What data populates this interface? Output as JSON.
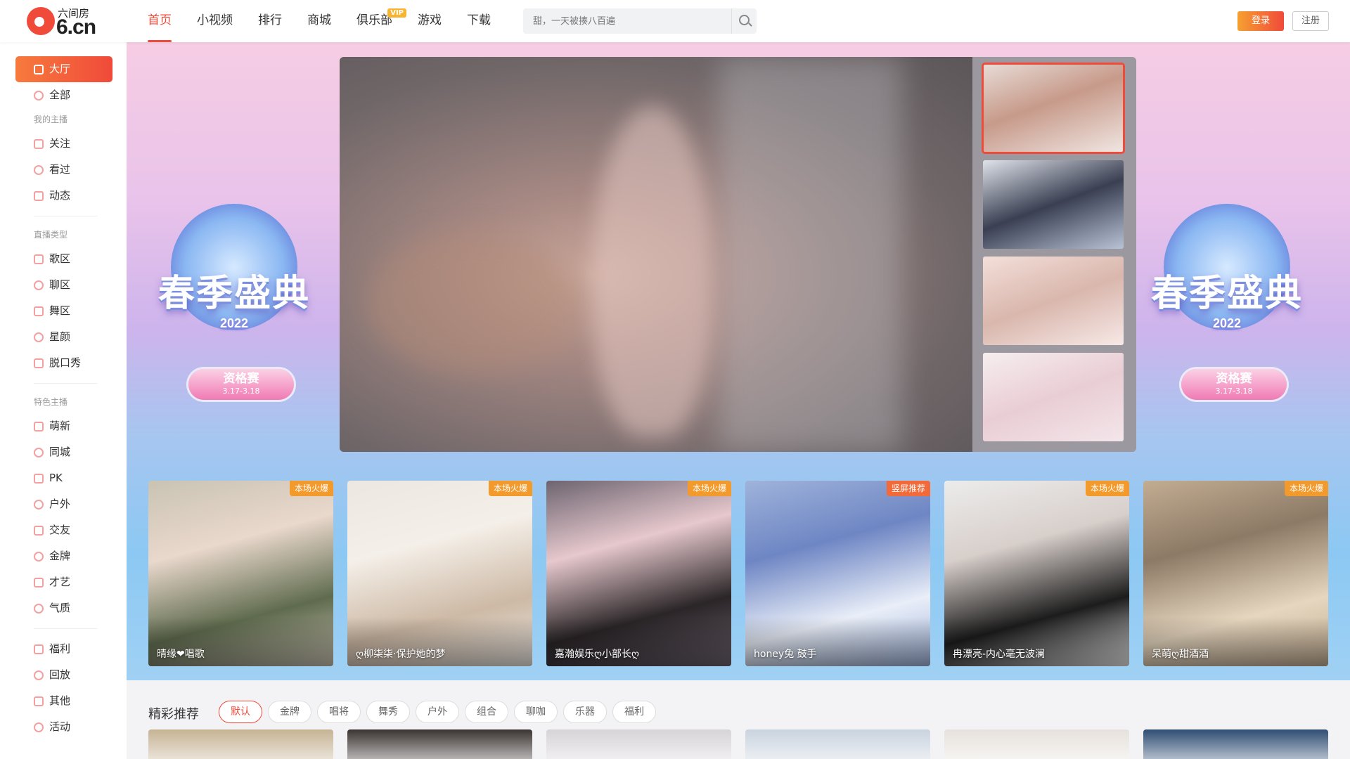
{
  "header": {
    "logo_text": "6.cn",
    "logo_sub": "六间房",
    "nav": [
      {
        "label": "首页",
        "active": true
      },
      {
        "label": "小视频"
      },
      {
        "label": "排行"
      },
      {
        "label": "商城"
      },
      {
        "label": "俱乐部",
        "badge": "VIP"
      },
      {
        "label": "游戏"
      },
      {
        "label": "下载"
      }
    ],
    "search_placeholder": "甜，一天被揍八百遍",
    "login_label": "登录",
    "register_label": "注册"
  },
  "sidebar": {
    "items_top": [
      {
        "label": "大厅",
        "icon": "home-icon",
        "active": true
      },
      {
        "label": "全部",
        "icon": "grid-icon"
      }
    ],
    "group_my": "我的主播",
    "items_my": [
      {
        "label": "关注",
        "icon": "heart-icon"
      },
      {
        "label": "看过",
        "icon": "clock-icon"
      },
      {
        "label": "动态",
        "icon": "message-icon"
      }
    ],
    "group_type": "直播类型",
    "items_type": [
      {
        "label": "歌区",
        "icon": "music-icon"
      },
      {
        "label": "聊区",
        "icon": "chat-icon"
      },
      {
        "label": "舞区",
        "icon": "dance-icon"
      },
      {
        "label": "星颜",
        "icon": "mask-icon"
      },
      {
        "label": "脱口秀",
        "icon": "mic-icon"
      }
    ],
    "group_feature": "特色主播",
    "items_feature": [
      {
        "label": "萌新",
        "icon": "sprout-icon"
      },
      {
        "label": "同城",
        "icon": "location-icon"
      },
      {
        "label": "PK",
        "icon": "lightning-icon"
      },
      {
        "label": "户外",
        "icon": "tent-icon"
      },
      {
        "label": "交友",
        "icon": "friends-icon"
      },
      {
        "label": "金牌",
        "icon": "medal-icon"
      },
      {
        "label": "才艺",
        "icon": "talent-icon"
      },
      {
        "label": "气质",
        "icon": "boot-icon"
      }
    ],
    "items_bottom": [
      {
        "label": "福利",
        "icon": "gift-icon"
      },
      {
        "label": "回放",
        "icon": "replay-icon"
      },
      {
        "label": "其他",
        "icon": "more-icon"
      },
      {
        "label": "活动",
        "icon": "star-icon"
      }
    ]
  },
  "banner": {
    "event_title": "春季盛典",
    "event_year": "2022",
    "event_stage": "资格赛",
    "event_dates": "3.17-3.18"
  },
  "live_cards": [
    {
      "name": "晴缘❤唱歌",
      "tag": "本场火爆",
      "colors": [
        "#c9c3b2",
        "#5f6b4e",
        "#e9d8cc"
      ]
    },
    {
      "name": "ღ柳柒柒·保护她的梦",
      "tag": "本场火爆",
      "colors": [
        "#ece7e1",
        "#cdb9a5",
        "#f4efe8"
      ]
    },
    {
      "name": "嘉瀚娱乐ღ小部长ღ",
      "tag": "本场火爆",
      "colors": [
        "#6d6470",
        "#2a2527",
        "#e6c8cd"
      ]
    },
    {
      "name": "honey兔 鼓手",
      "tag": "竖屏推荐",
      "colors": [
        "#9fb3da",
        "#e9eef8",
        "#6e86c4"
      ]
    },
    {
      "name": "冉漂亮-内心毫无波澜",
      "tag": "本场火爆",
      "colors": [
        "#ececec",
        "#1c1c1c",
        "#d8cfcb"
      ]
    },
    {
      "name": "呆萌ღ甜酒酒",
      "tag": "本场火爆",
      "colors": [
        "#c2ad92",
        "#e6d6bf",
        "#8d7a66"
      ]
    }
  ],
  "recommend": {
    "title": "精彩推荐",
    "filters": [
      {
        "label": "默认",
        "active": true
      },
      {
        "label": "金牌"
      },
      {
        "label": "唱将"
      },
      {
        "label": "舞秀"
      },
      {
        "label": "户外"
      },
      {
        "label": "组合"
      },
      {
        "label": "聊咖"
      },
      {
        "label": "乐器"
      },
      {
        "label": "福利"
      }
    ],
    "preview_colors": [
      "#c6b394",
      "#3b3432",
      "#d7d3d6",
      "#c9d3df",
      "#e6e1db",
      "#2f4d73"
    ]
  },
  "colors": {
    "accent": "#f04a3a",
    "tag": "#f39a2c",
    "vip": "#f8b430"
  }
}
